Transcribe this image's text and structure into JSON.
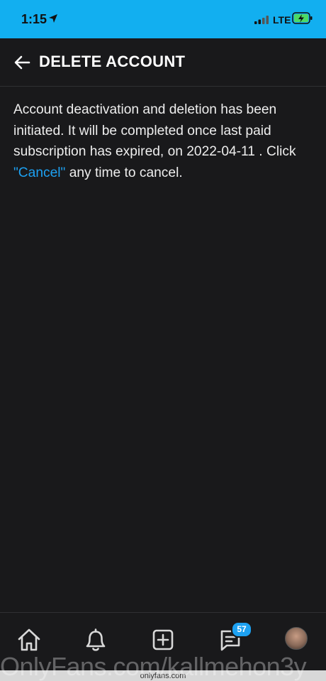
{
  "status_bar": {
    "time": "1:15",
    "network": "LTE",
    "colors": {
      "background": "#12aff0",
      "battery_fill": "#4cd964"
    }
  },
  "header": {
    "back_icon": "arrow-left-icon",
    "title": "DELETE ACCOUNT"
  },
  "message": {
    "text_before_link": "Account deactivation and deletion has been initiated. It will be completed once last paid subscription has expired, on 2022-04-11 . Click ",
    "link_text": "\"Cancel\"",
    "text_after_link": " any time to cancel."
  },
  "bottom_nav": {
    "items": [
      {
        "name": "home",
        "icon": "home-icon"
      },
      {
        "name": "notifications",
        "icon": "bell-icon"
      },
      {
        "name": "new-post",
        "icon": "plus-square-icon"
      },
      {
        "name": "messages",
        "icon": "message-icon",
        "badge": "57"
      },
      {
        "name": "profile",
        "icon": "avatar"
      }
    ]
  },
  "footer": {
    "site_url": "onlyfans.com",
    "watermark": "OnlyFans.com/kallmehon3y"
  },
  "colors": {
    "background": "#19191b",
    "accent": "#1da1f2",
    "text": "#eeeeee"
  }
}
